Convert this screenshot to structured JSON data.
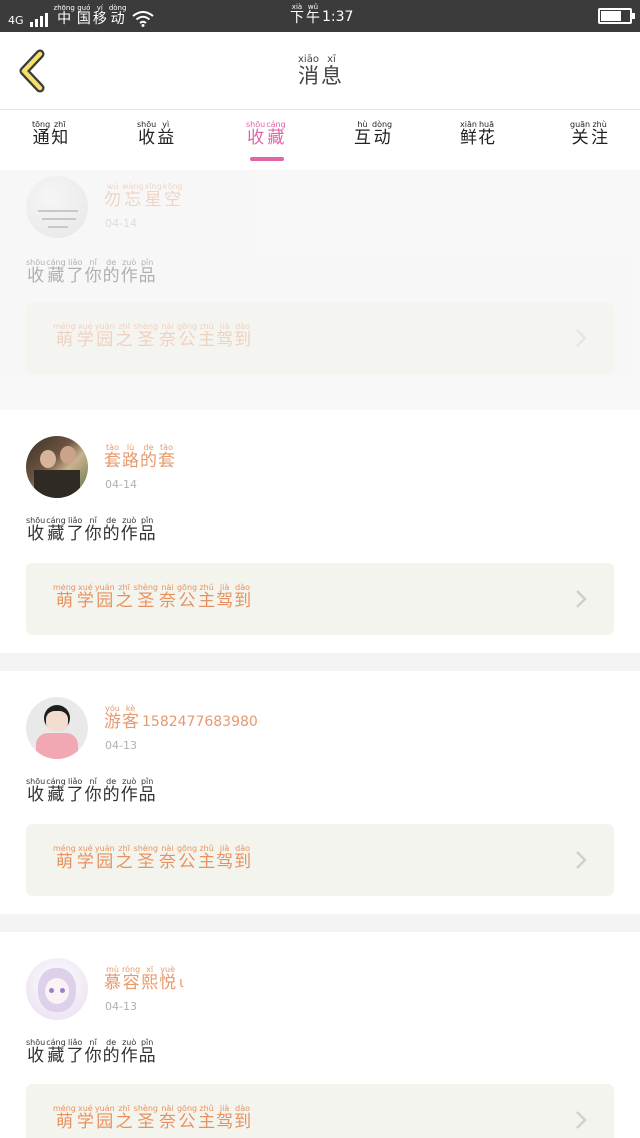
{
  "status_bar": {
    "network": "4G",
    "carrier": [
      [
        "zhōng",
        "中"
      ],
      [
        "guó",
        "国"
      ],
      [
        "yí",
        "移"
      ],
      [
        "dòng",
        "动"
      ]
    ],
    "time_prefix": [
      [
        "xià",
        "下"
      ],
      [
        "wǔ",
        "午"
      ]
    ],
    "time": "1:37",
    "battery_level": 0.65
  },
  "header": {
    "back_icon": "chevron-left-icon",
    "title": [
      [
        "xiāo",
        "消"
      ],
      [
        "xī",
        "息"
      ]
    ]
  },
  "tabs": [
    {
      "chars": [
        [
          "tōng",
          "通"
        ],
        [
          "zhī",
          "知"
        ]
      ],
      "active": false
    },
    {
      "chars": [
        [
          "shōu",
          "收"
        ],
        [
          "yì",
          "益"
        ]
      ],
      "active": false
    },
    {
      "chars": [
        [
          "shōu",
          "收"
        ],
        [
          "cáng",
          "藏"
        ]
      ],
      "active": true
    },
    {
      "chars": [
        [
          "hù",
          "互"
        ],
        [
          "dòng",
          "动"
        ]
      ],
      "active": false
    },
    {
      "chars": [
        [
          "xiān",
          "鲜"
        ],
        [
          "huā",
          "花"
        ]
      ],
      "active": false
    },
    {
      "chars": [
        [
          "guān",
          "关"
        ],
        [
          "zhù",
          "注"
        ]
      ],
      "active": false
    }
  ],
  "items": [
    {
      "user": [
        [
          "wù",
          "勿"
        ],
        [
          "wàng",
          "忘"
        ],
        [
          "xīng",
          "星"
        ],
        [
          "kōng",
          "空"
        ]
      ],
      "user_suffix": "",
      "date": "04-14",
      "action": [
        [
          "shōu",
          "收"
        ],
        [
          "cáng",
          "藏"
        ],
        [
          "liǎo",
          "了"
        ],
        [
          "nǐ",
          "你"
        ],
        [
          "de",
          "的"
        ],
        [
          "zuò",
          "作"
        ],
        [
          "pǐn",
          "品"
        ]
      ],
      "work": [
        [
          "méng",
          "萌"
        ],
        [
          "xué",
          "学"
        ],
        [
          "yuán",
          "园"
        ],
        [
          "zhī",
          "之"
        ],
        [
          "shèng",
          "圣"
        ],
        [
          "nài",
          "奈"
        ],
        [
          "gōng",
          "公"
        ],
        [
          "zhǔ",
          "主"
        ],
        [
          "jià",
          "驾"
        ],
        [
          "dào",
          "到"
        ]
      ],
      "faded": true
    },
    {
      "user": [
        [
          "tào",
          "套"
        ],
        [
          "lù",
          "路"
        ],
        [
          "de",
          "的"
        ],
        [
          "tào",
          "套"
        ]
      ],
      "user_suffix": "",
      "date": "04-14",
      "action": [
        [
          "shōu",
          "收"
        ],
        [
          "cáng",
          "藏"
        ],
        [
          "liǎo",
          "了"
        ],
        [
          "nǐ",
          "你"
        ],
        [
          "de",
          "的"
        ],
        [
          "zuò",
          "作"
        ],
        [
          "pǐn",
          "品"
        ]
      ],
      "work": [
        [
          "méng",
          "萌"
        ],
        [
          "xué",
          "学"
        ],
        [
          "yuán",
          "园"
        ],
        [
          "zhī",
          "之"
        ],
        [
          "shèng",
          "圣"
        ],
        [
          "nài",
          "奈"
        ],
        [
          "gōng",
          "公"
        ],
        [
          "zhǔ",
          "主"
        ],
        [
          "jià",
          "驾"
        ],
        [
          "dào",
          "到"
        ]
      ],
      "faded": false
    },
    {
      "user": [
        [
          "yóu",
          "游"
        ],
        [
          "kè",
          "客"
        ]
      ],
      "user_suffix": "1582477683980",
      "date": "04-13",
      "action": [
        [
          "shōu",
          "收"
        ],
        [
          "cáng",
          "藏"
        ],
        [
          "liǎo",
          "了"
        ],
        [
          "nǐ",
          "你"
        ],
        [
          "de",
          "的"
        ],
        [
          "zuò",
          "作"
        ],
        [
          "pǐn",
          "品"
        ]
      ],
      "work": [
        [
          "méng",
          "萌"
        ],
        [
          "xué",
          "学"
        ],
        [
          "yuán",
          "园"
        ],
        [
          "zhī",
          "之"
        ],
        [
          "shèng",
          "圣"
        ],
        [
          "nài",
          "奈"
        ],
        [
          "gōng",
          "公"
        ],
        [
          "zhǔ",
          "主"
        ],
        [
          "jià",
          "驾"
        ],
        [
          "dào",
          "到"
        ]
      ],
      "faded": false
    },
    {
      "user": [
        [
          "mù",
          "慕"
        ],
        [
          "róng",
          "容"
        ],
        [
          "xī",
          "熙"
        ],
        [
          "yuè",
          "悦"
        ]
      ],
      "user_suffix": "ι",
      "date": "04-13",
      "action": [
        [
          "shōu",
          "收"
        ],
        [
          "cáng",
          "藏"
        ],
        [
          "liǎo",
          "了"
        ],
        [
          "nǐ",
          "你"
        ],
        [
          "de",
          "的"
        ],
        [
          "zuò",
          "作"
        ],
        [
          "pǐn",
          "品"
        ]
      ],
      "work": [
        [
          "méng",
          "萌"
        ],
        [
          "xué",
          "学"
        ],
        [
          "yuán",
          "园"
        ],
        [
          "zhī",
          "之"
        ],
        [
          "shèng",
          "圣"
        ],
        [
          "nài",
          "奈"
        ],
        [
          "gōng",
          "公"
        ],
        [
          "zhǔ",
          "主"
        ],
        [
          "jià",
          "驾"
        ],
        [
          "dào",
          "到"
        ]
      ],
      "faded": false
    }
  ],
  "item_icon": "chevron-right-icon"
}
